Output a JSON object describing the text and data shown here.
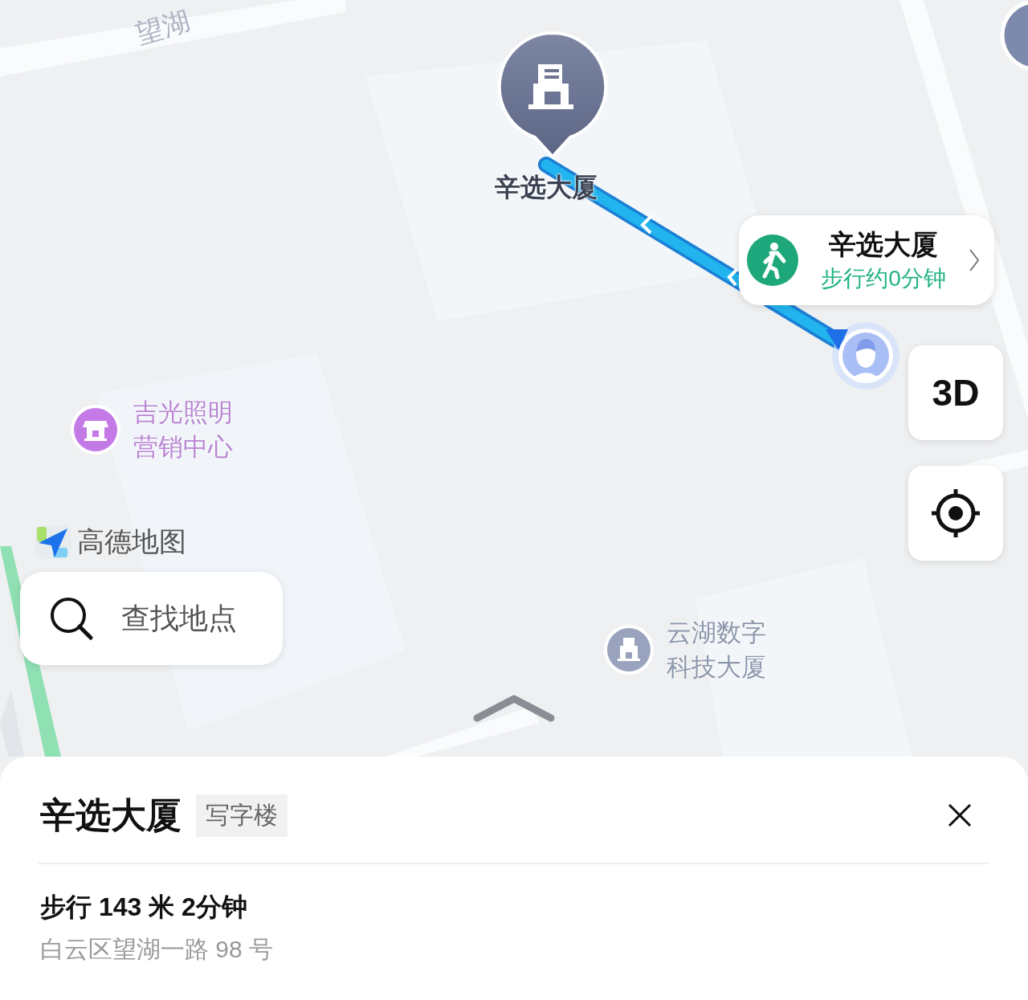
{
  "map": {
    "street_label": "望湖",
    "destination": {
      "name": "辛选大厦"
    },
    "route_card": {
      "title": "辛选大厦",
      "subtitle": "步行约0分钟"
    },
    "pois": [
      {
        "kind": "shop",
        "lines": [
          "吉光照明",
          "营销中心"
        ],
        "color": "#c47ae6"
      },
      {
        "kind": "building",
        "lines": [
          "云湖数字",
          "科技大厦"
        ],
        "color": "#9aa3bd"
      }
    ],
    "controls": [
      {
        "kind": "perspective",
        "label": "3D"
      },
      {
        "kind": "locate"
      }
    ],
    "logo": {
      "text": "高德地图"
    },
    "search": {
      "placeholder": "查找地点"
    }
  },
  "sheet": {
    "title": "辛选大厦",
    "tag": "写字楼",
    "walk": "步行 143 米 2分钟",
    "address": "白云区望湖一路 98 号"
  }
}
